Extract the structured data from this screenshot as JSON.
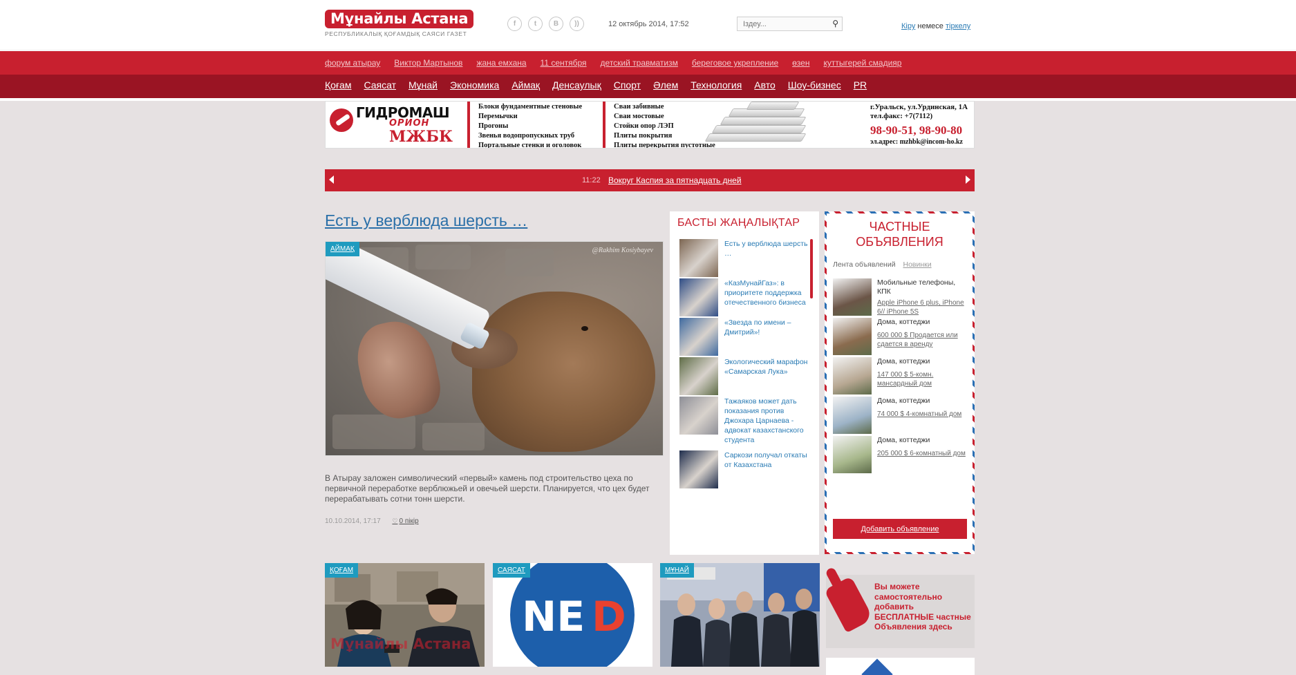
{
  "header": {
    "logo_text": "Мұнайлы Астана",
    "logo_subtitle": "РЕСПУБЛИКАЛЫҚ ҚОҒАМДЫҚ САЯСИ ГАЗЕТ",
    "social_icons": [
      "facebook-icon",
      "twitter-icon",
      "vk-icon",
      "rss-icon"
    ],
    "social_glyphs": [
      "f",
      "t",
      "В",
      "))"
    ],
    "date": "12 октябрь 2014, 17:52",
    "search_placeholder": "Іздеу...",
    "auth": {
      "login": "Кіру",
      "or": "немесе",
      "register": "тіркелу"
    }
  },
  "tags": [
    "форум атырау",
    "Виктор Мартынов",
    "жана емхана",
    "11 сентября",
    "детский травматизм",
    "береговое укрепление",
    "өзен",
    "куттыгерей смадияр"
  ],
  "nav": [
    "Қоғам",
    "Саясат",
    "Мұнай",
    "Экономика",
    "Аймақ",
    "Денсаулық",
    "Спорт",
    "Әлем",
    "Технология",
    "Авто",
    "Шоу-бизнес",
    "PR"
  ],
  "banner": {
    "brand1": "ГИДРОМАШ",
    "brand2": "ОРИОН",
    "brand3": "МЖБК",
    "products_left": [
      "Блоки фундаментные стеновые",
      "Перемычки",
      "Прогоны",
      "Звенья водопропускных труб",
      "Портальные стенки и оголовок"
    ],
    "products_right": [
      "Сваи забивные",
      "Сваи мостовые",
      "Стойки опор ЛЭП",
      "Плиты покрытия",
      "Плиты перекрытия пустотные"
    ],
    "address": "г.Уральск, ул.Урдинская, 1А",
    "fax": "тел.факс: +7(7112)",
    "phones": "98-90-51, 98-90-80",
    "email": "эл.адрес: mzhbk@incom-ho.kz"
  },
  "ticker": {
    "time": "11:22",
    "headline": "Вокруг Каспия за пятнадцать дней"
  },
  "featured": {
    "title": "Есть у верблюда шерсть …",
    "category": "АЙМАҚ",
    "photo_credit": "@Rakhim Kosiybayev",
    "lead": "В Атырау заложен символический «первый» камень под строительство цеха по первичной переработке верблюжьей и овечьей шерсти. Планируется, что цех будет перерабатывать сотни тонн шерсти.",
    "date": "10.10.2014, 17:17",
    "comments": "0 пікір"
  },
  "news": {
    "heading": "БАСТЫ ЖАҢАЛЫҚТАР",
    "items": [
      {
        "text": "Есть у верблюда шерсть …",
        "thumb_color": "#7d6652"
      },
      {
        "text": "«КазМунайГаз»: в приоритете поддержка отечественного бизнеса",
        "thumb_color": "#2f4d86"
      },
      {
        "text": "«Звезда по имени – Дмитрий»!",
        "thumb_color": "#3f6aa0"
      },
      {
        "text": "Экологический марафон «Самарская Лука»",
        "thumb_color": "#5f6d47"
      },
      {
        "text": "Тажаяков может дать показания против Джохара Царнаева - адвокат казахстанского студента",
        "thumb_color": "#8e8f97"
      },
      {
        "text": "Саркози получал откаты от Казахстана",
        "thumb_color": "#1f2d4c"
      }
    ]
  },
  "ads": {
    "heading_line1": "ЧАСТНЫЕ",
    "heading_line2": "ОБЪЯВЛЕНИЯ",
    "tab_active": "Лента объявлений",
    "tab_inactive": "Новинки",
    "items": [
      {
        "category": "Мобильные телефоны, КПК",
        "link": "Apple iPhone 6 plus, iPhone 6// iPhone 5S",
        "thumb_color": "#6b5547"
      },
      {
        "category": "Дома, коттеджи",
        "link": "600 000 $ Продается или сдается в аренду",
        "thumb_color": "#8a6b4e"
      },
      {
        "category": "Дома, коттеджи",
        "link": "147 000 $ 5-комн. мансардный дом",
        "thumb_color": "#b7a792"
      },
      {
        "category": "Дома, коттеджи",
        "link": "74 000 $ 4-комнатный дом",
        "thumb_color": "#9db3c7"
      },
      {
        "category": "Дома, коттеджи",
        "link": "205 000 $ 6-комнатный дом",
        "thumb_color": "#a7b78b"
      }
    ],
    "button": "Добавить объявление"
  },
  "cards": [
    {
      "category": "ҚОҒАМ",
      "watermark": "Мұнайлы Астана"
    },
    {
      "category": "САЯСАТ",
      "logo_text_1": "NE",
      "logo_text_2": "D"
    },
    {
      "category": "МҰНАЙ"
    }
  ],
  "promo": {
    "text": "Вы можете самостоятельно добавить БЕСПЛАТНЫЕ частные Объявления здесь"
  },
  "colors": {
    "brand_red": "#c8202f",
    "dark_red": "#9a1423",
    "link_blue": "#2a7bb4",
    "category_teal": "#1f9bbf",
    "page_bg": "#e6e1e2"
  }
}
